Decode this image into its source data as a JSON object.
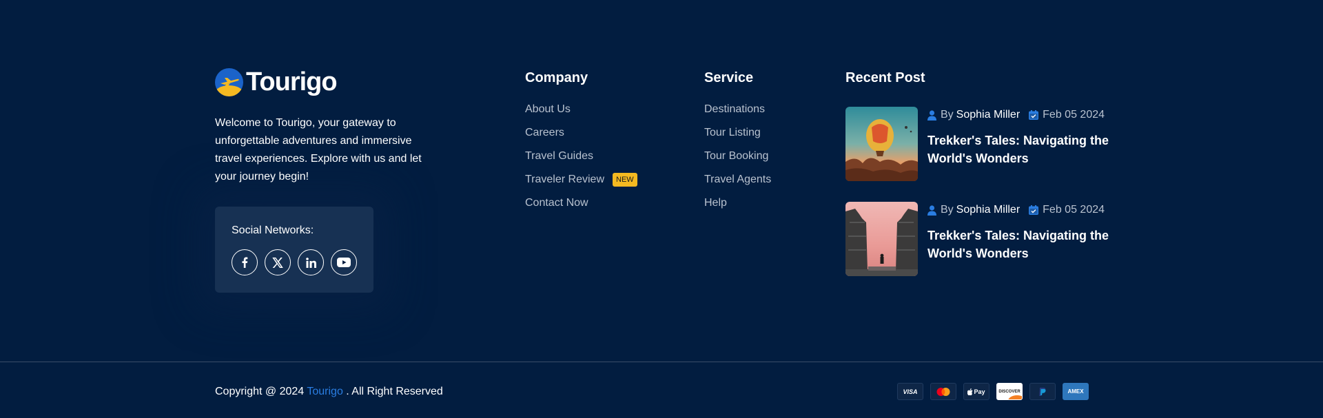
{
  "brand": {
    "name": "Tourigo",
    "description": "Welcome to Tourigo, your gateway to unforgettable adventures and immersive travel experiences. Explore with us and let your journey begin!",
    "social_label": "Social Networks:",
    "social_icons": [
      "facebook-icon",
      "x-icon",
      "linkedin-icon",
      "youtube-icon"
    ]
  },
  "company": {
    "title": "Company",
    "links": [
      "About Us",
      "Careers",
      "Travel Guides",
      "Traveler Review",
      "Contact Now"
    ],
    "badge": "NEW"
  },
  "service": {
    "title": "Service",
    "links": [
      "Destinations",
      "Tour Listing",
      "Tour Booking",
      "Travel Agents",
      "Help"
    ]
  },
  "recent": {
    "title": "Recent Post",
    "posts": [
      {
        "by": "By",
        "author": "Sophia Miller",
        "date": "Feb 05 2024",
        "title": "Trekker's Tales: Navigating the World's Wonders",
        "image": "hot-air-balloon"
      },
      {
        "by": "By",
        "author": "Sophia Miller",
        "date": "Feb 05 2024",
        "title": "Trekker's Tales: Navigating the World's Wonders",
        "image": "temple-gate"
      }
    ]
  },
  "footer": {
    "copyright_prefix": "Copyright @ 2024",
    "copyright_brand": "Tourigo",
    "copyright_suffix": ". All Right Reserved",
    "payments": [
      "visa-icon",
      "mastercard-icon",
      "apple-pay-icon",
      "discover-icon",
      "paypal-icon",
      "amex-icon"
    ],
    "payment_labels": {
      "visa": "VISA",
      "apple_pay": "Pay",
      "discover": "DISCOVER",
      "amex": "AMEX"
    }
  },
  "colors": {
    "background": "#021d40",
    "accent_blue": "#2a7de1",
    "accent_yellow": "#f5b921",
    "muted_text": "#b9c2cf"
  }
}
